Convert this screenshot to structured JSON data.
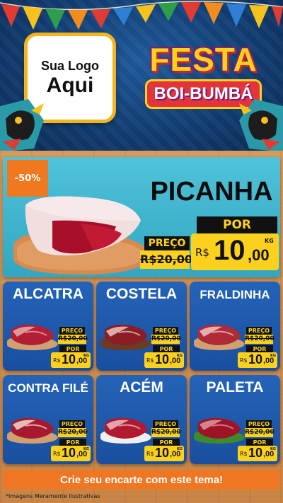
{
  "header": {
    "logo_line1": "Sua Logo",
    "logo_line2": "Aqui",
    "theme_title": "FESTA",
    "theme_subtitle": "BOI-BUMBÁ"
  },
  "hero": {
    "discount": "-50%",
    "name": "PICANHA",
    "old_label": "PREÇO",
    "old_price": "R$20,00",
    "new_label": "POR",
    "currency": "R$",
    "price_int": "10",
    "price_dec": ",00",
    "unit": "KG"
  },
  "products": [
    {
      "name": "ALCATRA",
      "old_label": "PREÇO",
      "old_price": "R$20,00",
      "new_label": "POR",
      "currency": "R$",
      "price_int": "10",
      "price_dec": ",00",
      "unit": "KG"
    },
    {
      "name": "COSTELA",
      "old_label": "PREÇO",
      "old_price": "R$20,00",
      "new_label": "POR",
      "currency": "R$",
      "price_int": "10",
      "price_dec": ",00",
      "unit": "KG"
    },
    {
      "name": "FRALDINHA",
      "old_label": "PREÇO",
      "old_price": "R$20,00",
      "new_label": "POR",
      "currency": "R$",
      "price_int": "10",
      "price_dec": ",00",
      "unit": "KG"
    },
    {
      "name": "CONTRA FILÉ",
      "old_label": "PREÇO",
      "old_price": "R$20,00",
      "new_label": "POR",
      "currency": "R$",
      "price_int": "10",
      "price_dec": ",00",
      "unit": "KG"
    },
    {
      "name": "ACÉM",
      "old_label": "PREÇO",
      "old_price": "R$20,00",
      "new_label": "POR",
      "currency": "R$",
      "price_int": "10",
      "price_dec": ",00",
      "unit": "KG"
    },
    {
      "name": "PALETA",
      "old_label": "PREÇO",
      "old_price": "R$20,00",
      "new_label": "POR",
      "currency": "R$",
      "price_int": "10",
      "price_dec": ",00",
      "unit": "KG"
    }
  ],
  "footer": {
    "cta": "Crie seu encarte com este tema!",
    "disclaimer": "*Imagens Meramente Ilustrativas"
  },
  "colors": {
    "header_bg": "#123e73",
    "hero_bg": "#33a6c2",
    "card_bg": "#1a4f9e",
    "price_yellow": "#fbd11e",
    "accent_orange": "#ef7622",
    "wood": "#c98a4b"
  }
}
